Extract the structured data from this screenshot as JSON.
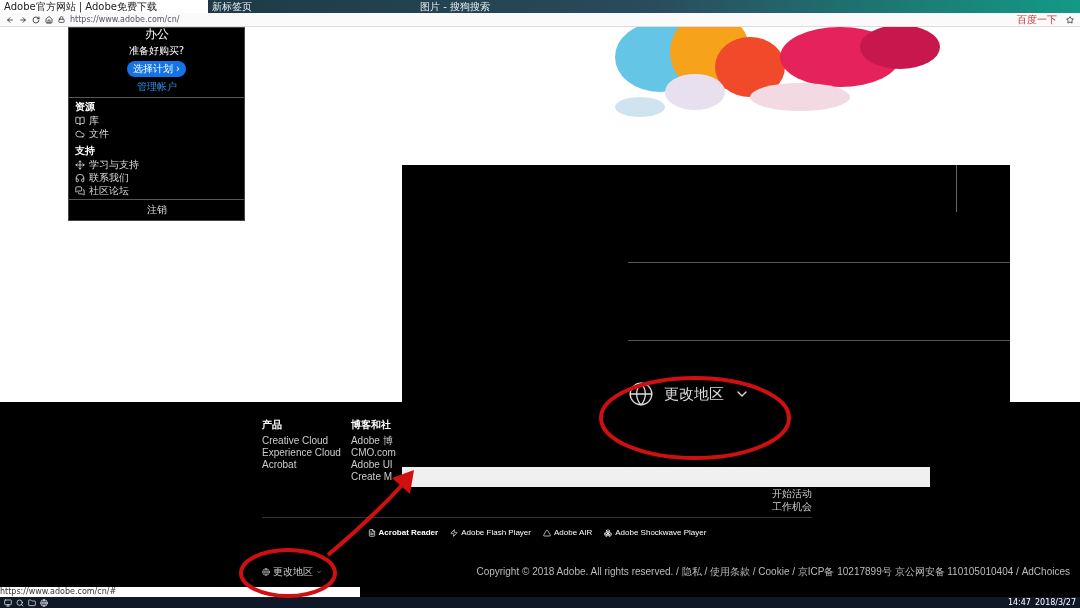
{
  "browser": {
    "tabs": [
      {
        "title": "Adobe官方网站 | Adobe免费下载",
        "selected": true
      },
      {
        "title": "新标签页",
        "selected": false
      },
      {
        "title": "图片 - 搜狗搜索",
        "selected": false
      }
    ],
    "address": "https://www.adobe.com/cn/",
    "search": "百度一下"
  },
  "account_menu": {
    "title": "办公",
    "prompt": "准备好购买?",
    "plan_button": "选择计划 ›",
    "account_link": "管理帐户",
    "sections": [
      {
        "heading": "资源",
        "items": [
          {
            "label": "库",
            "kind": "library"
          },
          {
            "label": "文件",
            "kind": "cloud"
          }
        ]
      },
      {
        "heading": "支持",
        "items": [
          {
            "label": "学习与支持",
            "kind": "learn"
          },
          {
            "label": "联系我们",
            "kind": "contact"
          },
          {
            "label": "社区论坛",
            "kind": "forum"
          }
        ]
      }
    ],
    "sign_out": "注销"
  },
  "zoom_overlay": {
    "region": "更改地区"
  },
  "footer": {
    "columns": [
      {
        "heading": "产品",
        "links": [
          "Creative Cloud",
          "Experience Cloud",
          "Acrobat"
        ]
      },
      {
        "heading": "博客和社",
        "links": [
          "Adobe 博",
          "CMO.com",
          "Adobe UI",
          "Create M"
        ]
      }
    ],
    "right_links": [
      "开始活动",
      "工作机会"
    ],
    "products": [
      {
        "name": "Acrobat Reader",
        "kind": "acrobat",
        "emphasized": true
      },
      {
        "name": "Adobe Flash Player",
        "kind": "flash",
        "emphasized": false
      },
      {
        "name": "Adobe AIR",
        "kind": "air",
        "emphasized": false
      },
      {
        "name": "Adobe Shockwave Player",
        "kind": "shockwave",
        "emphasized": false
      }
    ],
    "region": "更改地区",
    "copyright": "Copyright © 2018 Adobe. All rights reserved. / 隐私 / 使用条款 / Cookie / 京ICP备 10217899号 京公网安备 110105010404 / AdChoices"
  },
  "status_url": "https://www.adobe.com/cn/#",
  "taskbar": {
    "time": "14:47",
    "date": "2018/3/27"
  }
}
